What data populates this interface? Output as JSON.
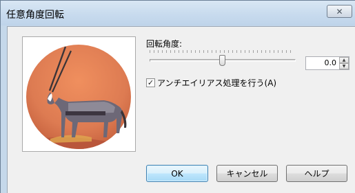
{
  "window": {
    "title": "任意角度回転",
    "close_icon": "close-x-icon",
    "accent": "#3c7fb1"
  },
  "preview": {
    "description_icon": "oryx-preview-image",
    "sky_color": "#dd7d52",
    "ground_color": "#c15c3e"
  },
  "rotation": {
    "label": "回転角度:",
    "value": "0.0",
    "slider_level": 0.5,
    "up_icon": "spin-up-icon",
    "down_icon": "spin-down-icon"
  },
  "antialias": {
    "label": "アンチエイリアス処理を行う(A)",
    "checked": true
  },
  "buttons": {
    "ok": "OK",
    "cancel": "キャンセル",
    "help": "ヘルプ"
  }
}
